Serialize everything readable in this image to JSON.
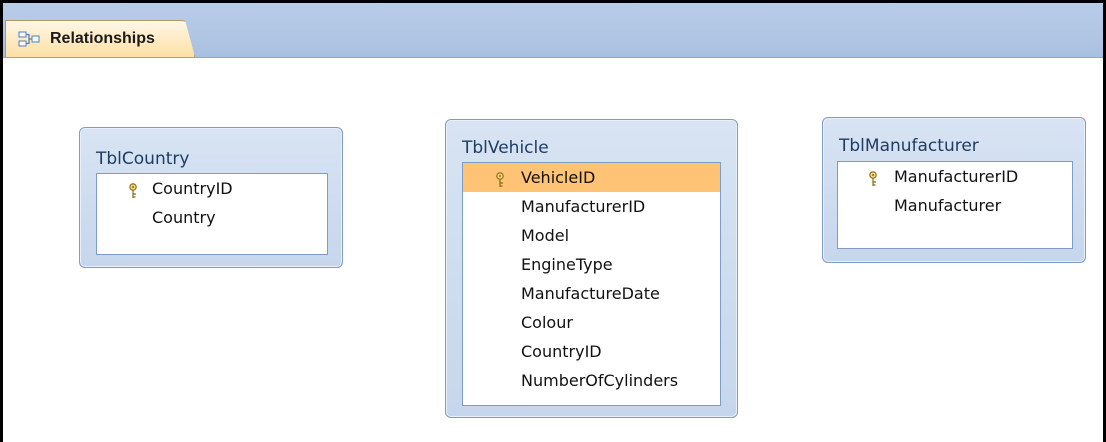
{
  "tab": {
    "label": "Relationships",
    "icon": "relationships-icon"
  },
  "tables": [
    {
      "id": "country",
      "title": "TblCountry",
      "fields": [
        {
          "name": "CountryID",
          "pk": true,
          "selected": false
        },
        {
          "name": "Country",
          "pk": false,
          "selected": false
        }
      ]
    },
    {
      "id": "vehicle",
      "title": "TblVehicle",
      "fields": [
        {
          "name": "VehicleID",
          "pk": true,
          "selected": true
        },
        {
          "name": "ManufacturerID",
          "pk": false,
          "selected": false
        },
        {
          "name": "Model",
          "pk": false,
          "selected": false
        },
        {
          "name": "EngineType",
          "pk": false,
          "selected": false
        },
        {
          "name": "ManufactureDate",
          "pk": false,
          "selected": false
        },
        {
          "name": "Colour",
          "pk": false,
          "selected": false
        },
        {
          "name": "CountryID",
          "pk": false,
          "selected": false
        },
        {
          "name": "NumberOfCylinders",
          "pk": false,
          "selected": false
        }
      ]
    },
    {
      "id": "manufacturer",
      "title": "TblManufacturer",
      "fields": [
        {
          "name": "ManufacturerID",
          "pk": true,
          "selected": false
        },
        {
          "name": "Manufacturer",
          "pk": false,
          "selected": false
        }
      ]
    }
  ]
}
